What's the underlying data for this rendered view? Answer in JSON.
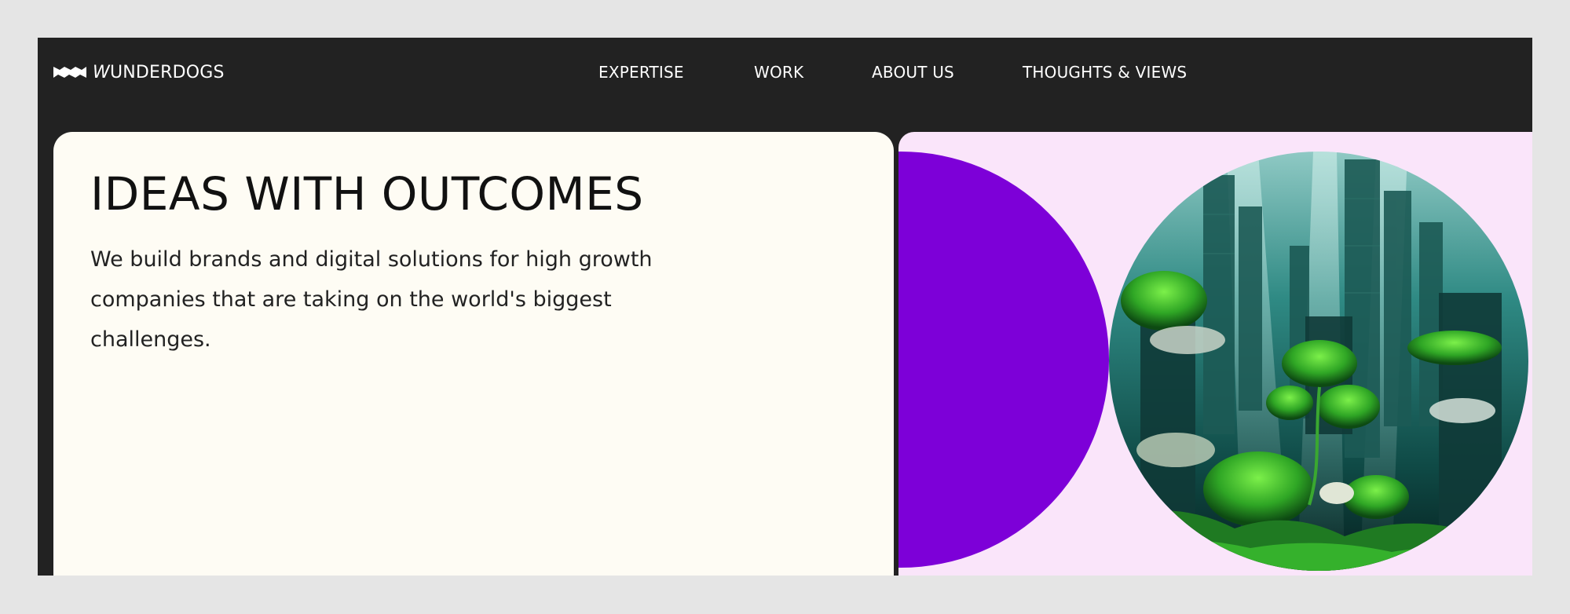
{
  "brand": {
    "name_initial": "W",
    "name_rest": "UNDERDOGS"
  },
  "nav": {
    "items": [
      "EXPERTISE",
      "WORK",
      "ABOUT US",
      "THOUGHTS & VIEWS"
    ]
  },
  "hero": {
    "title": "IDEAS WITH OUTCOMES",
    "description": "We build brands and digital solutions for high growth companies that are taking on the world's biggest challenges."
  },
  "colors": {
    "page_background": "#e5e5e5",
    "header_background": "#222222",
    "hero_card": "#fefcf4",
    "visual_panel": "#fae5fa",
    "accent_purple": "#7d00d8"
  },
  "icons": {
    "logo_mark": "wave-logo-icon"
  }
}
